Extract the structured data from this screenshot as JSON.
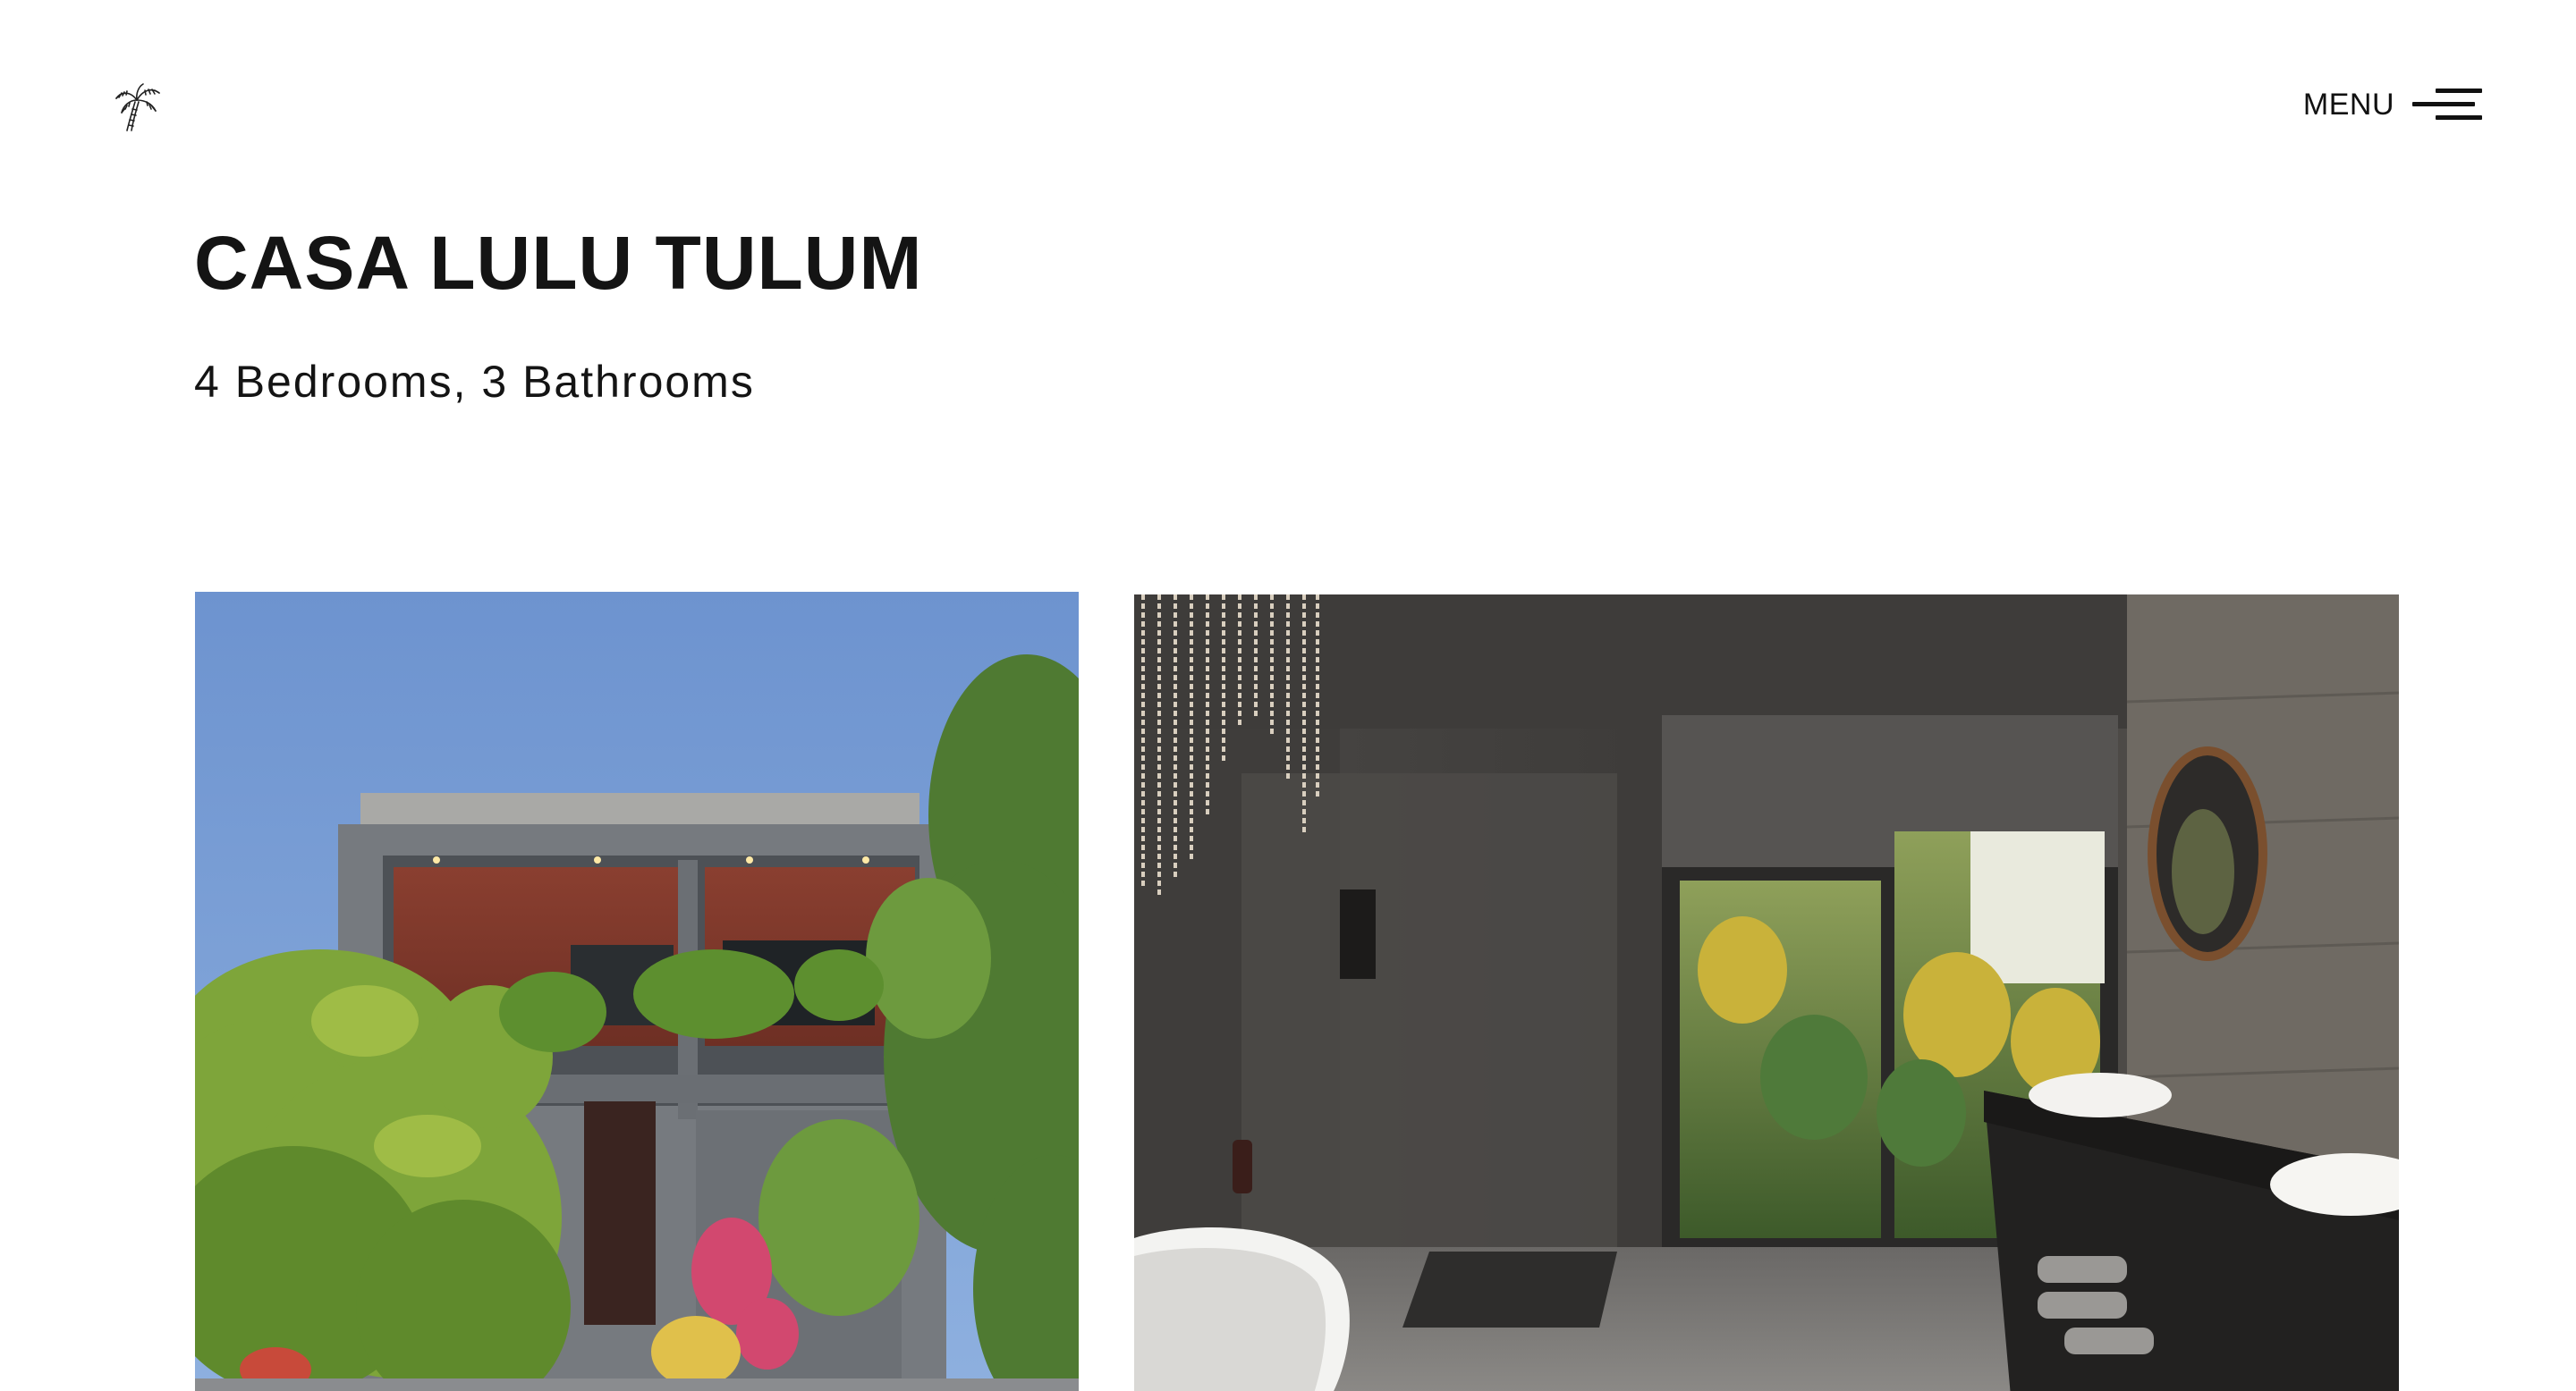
{
  "header": {
    "logo_icon": "palm-tree-icon",
    "menu_label": "MENU",
    "menu_icon": "hamburger-menu-icon"
  },
  "property": {
    "title": "CASA LULU TULUM",
    "details": "4 Bedrooms, 3 Bathrooms"
  },
  "gallery": {
    "images": [
      {
        "subject": "house-exterior-photo"
      },
      {
        "subject": "bathroom-interior-photo"
      }
    ]
  },
  "colors": {
    "text": "#141414",
    "background": "#ffffff"
  }
}
